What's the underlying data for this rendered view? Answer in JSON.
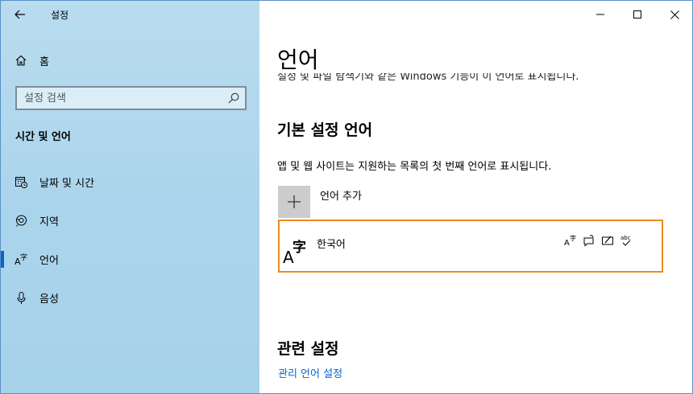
{
  "app": {
    "title": "설정"
  },
  "sidebar": {
    "home_label": "홈",
    "search_placeholder": "설정 검색",
    "section_label": "시간 및 언어",
    "items": [
      {
        "label": "날짜 및 시간",
        "icon": "calendar-clock-icon",
        "active": false
      },
      {
        "label": "지역",
        "icon": "globe-icon",
        "active": false
      },
      {
        "label": "언어",
        "icon": "language-icon",
        "active": true
      },
      {
        "label": "음성",
        "icon": "microphone-icon",
        "active": false
      }
    ]
  },
  "main": {
    "page_title": "언어",
    "cut_text": "설정 및 파일 탐색기와 같은 Windows 기능이 이 언어로 표시됩니다.",
    "preferred_heading": "기본 설정 언어",
    "preferred_desc": "앱 및 웹 사이트는 지원하는 목록의 첫 번째 언어로 표시됩니다.",
    "add_language_label": "언어 추가",
    "languages": [
      {
        "name": "한국어",
        "features": [
          "display-language-icon",
          "speech-icon",
          "handwriting-icon",
          "spellcheck-icon"
        ]
      }
    ],
    "related_heading": "관련 설정",
    "related_link": "관리 언어 설정"
  },
  "colors": {
    "accent": "#0a64c8",
    "selection_border": "#ef8a1f",
    "sidebar_bg": "#aad4ec"
  }
}
